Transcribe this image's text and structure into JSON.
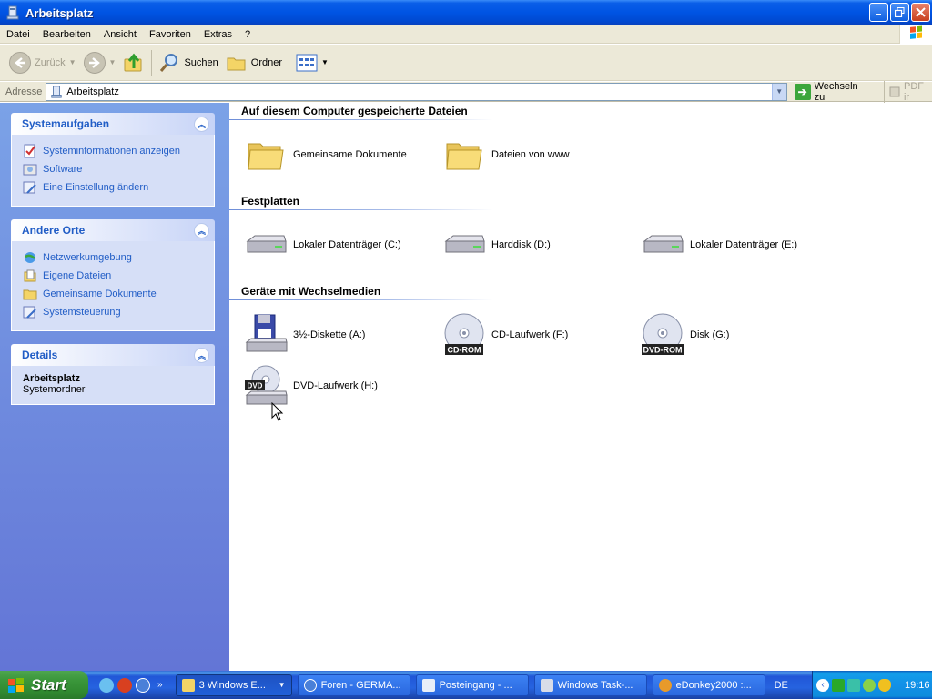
{
  "window": {
    "title": "Arbeitsplatz"
  },
  "menu": [
    "Datei",
    "Bearbeiten",
    "Ansicht",
    "Favoriten",
    "Extras",
    "?"
  ],
  "toolbar": {
    "back": "Zurück",
    "search": "Suchen",
    "folders": "Ordner"
  },
  "address": {
    "label": "Adresse",
    "value": "Arbeitsplatz",
    "go": "Wechseln zu",
    "pdf": "PDF ir"
  },
  "sidebar": {
    "system": {
      "title": "Systemaufgaben",
      "items": [
        "Systeminformationen anzeigen",
        "Software",
        "Eine Einstellung ändern"
      ]
    },
    "other": {
      "title": "Andere Orte",
      "items": [
        "Netzwerkumgebung",
        "Eigene Dateien",
        "Gemeinsame Dokumente",
        "Systemsteuerung"
      ]
    },
    "details": {
      "title": "Details",
      "name": "Arbeitsplatz",
      "type": "Systemordner"
    }
  },
  "groups": {
    "files": {
      "title": "Auf diesem Computer gespeicherte Dateien",
      "items": [
        "Gemeinsame Dokumente",
        "Dateien von www"
      ]
    },
    "drives": {
      "title": "Festplatten",
      "items": [
        "Lokaler Datenträger (C:)",
        "Harddisk (D:)",
        "Lokaler Datenträger (E:)"
      ]
    },
    "removable": {
      "title": "Geräte mit Wechselmedien",
      "items": [
        "3½-Diskette (A:)",
        "CD-Laufwerk (F:)",
        "Disk (G:)",
        "DVD-Laufwerk (H:)"
      ],
      "badges": {
        "cd": "CD-ROM",
        "dvdrom": "DVD-ROM",
        "dvd": "DVD"
      }
    }
  },
  "taskbar": {
    "start": "Start",
    "buttons": [
      "3 Windows E...",
      "Foren - GERMA...",
      "Posteingang - ...",
      "Windows Task-...",
      "eDonkey2000 :..."
    ],
    "language": "DE",
    "clock": "19:16",
    "quicklaunch_more": "»"
  },
  "colors": {
    "accent": "#215dc6",
    "sidebar_top": "#7ba2e7",
    "sidebar_bottom": "#6375d6",
    "titlebar": "#0054e3"
  }
}
